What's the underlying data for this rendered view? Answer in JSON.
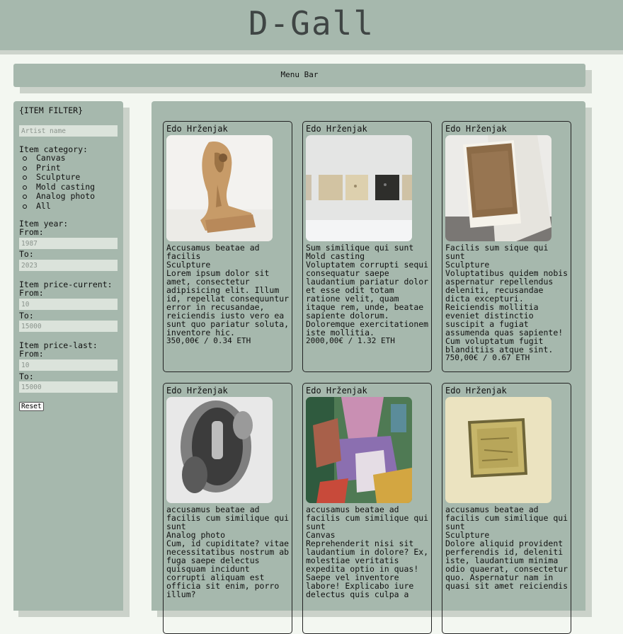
{
  "site": {
    "title": "D-Gall",
    "menu_label": "Menu Bar"
  },
  "filter": {
    "title": "{ITEM FILTER}",
    "artist_placeholder": "Artist name",
    "category_label": "Item category:",
    "categories": [
      "Canvas",
      "Print",
      "Sculpture",
      "Mold casting",
      "Analog photo",
      "All"
    ],
    "year_label": "Item year:",
    "year_from_label": "From:",
    "year_from_placeholder": "1987",
    "year_to_label": "To:",
    "year_to_placeholder": "2023",
    "price_current_label": "Item price-current:",
    "price_current_from_label": "From:",
    "price_current_from_placeholder": "10",
    "price_current_to_label": "To:",
    "price_current_to_placeholder": "15000",
    "price_last_label": "Item price-last:",
    "price_last_from_label": "From:",
    "price_last_from_placeholder": "10",
    "price_last_to_label": "To:",
    "price_last_to_placeholder": "15000",
    "reset_label": "Reset"
  },
  "items": [
    {
      "artist": "Edo Hrženjak",
      "image": "wood-sculpture-photo",
      "title": "Accusamus beatae ad facilis",
      "category": "Sculpture",
      "description": "Lorem ipsum dolor sit amet, consectetur adipisicing elit. Illum id, repellat consequuntur error in recusandae, reiciendis iusto vero ea sunt quo pariatur soluta, inventore hic.",
      "price": "350,00€ / 0.34 ETH"
    },
    {
      "artist": "Edo Hrženjak",
      "image": "mold-casting-wall-photo",
      "title": "Sum similique qui sunt",
      "category": "Mold casting",
      "description": "Voluptatem corrupti sequi consequatur saepe laudantium pariatur dolor et esse odit totam ratione velit, quam itaque rem, unde, beatae sapiente dolorum. Doloremque exercitationem iste mollitia.",
      "price": "2000,00€ / 1.32 ETH"
    },
    {
      "artist": "Edo Hrženjak",
      "image": "textured-panel-photo",
      "title": "Facilis sum sique qui sunt",
      "category": "Sculpture",
      "description": "Voluptatibus quidem nobis aspernatur repellendus deleniti, recusandae dicta excepturi. Reiciendis mollitia eveniet distinctio suscipit a fugiat assumenda quas sapiente! Cum voluptatum fugit blanditiis atque sint.",
      "price": "750,00€ / 0.67 ETH"
    },
    {
      "artist": "Edo Hrženjak",
      "image": "bw-abstract-photo",
      "title": "accusamus beatae ad facilis cum similique qui sunt",
      "category": "Analog photo",
      "description": "Cum, id cupiditate? vitae necessitatibus nostrum ab fuga saepe delectus quisquam incidunt corrupti aliquam est officia sit enim, porro illum?",
      "price": ""
    },
    {
      "artist": "Edo Hrženjak",
      "image": "colorful-canvas-photo",
      "title": "accusamus beatae ad facilis cum similique qui sunt",
      "category": "Canvas",
      "description": "Reprehenderit nisi sit laudantium in dolore? Ex, molestiae veritatis expedita optio in quas! Saepe vel inventore labore! Explicabo iure delectus quis culpa a",
      "price": ""
    },
    {
      "artist": "Edo Hrženjak",
      "image": "yellow-relief-photo",
      "title": "accusamus beatae ad facilis cum similique qui sunt",
      "category": "Sculpture",
      "description": "Dolore aliquid provident perferendis id, deleniti iste, laudantium minima odio quaerat, consectetur quo. Aspernatur nam in quasi sit amet reiciendis",
      "price": ""
    }
  ]
}
